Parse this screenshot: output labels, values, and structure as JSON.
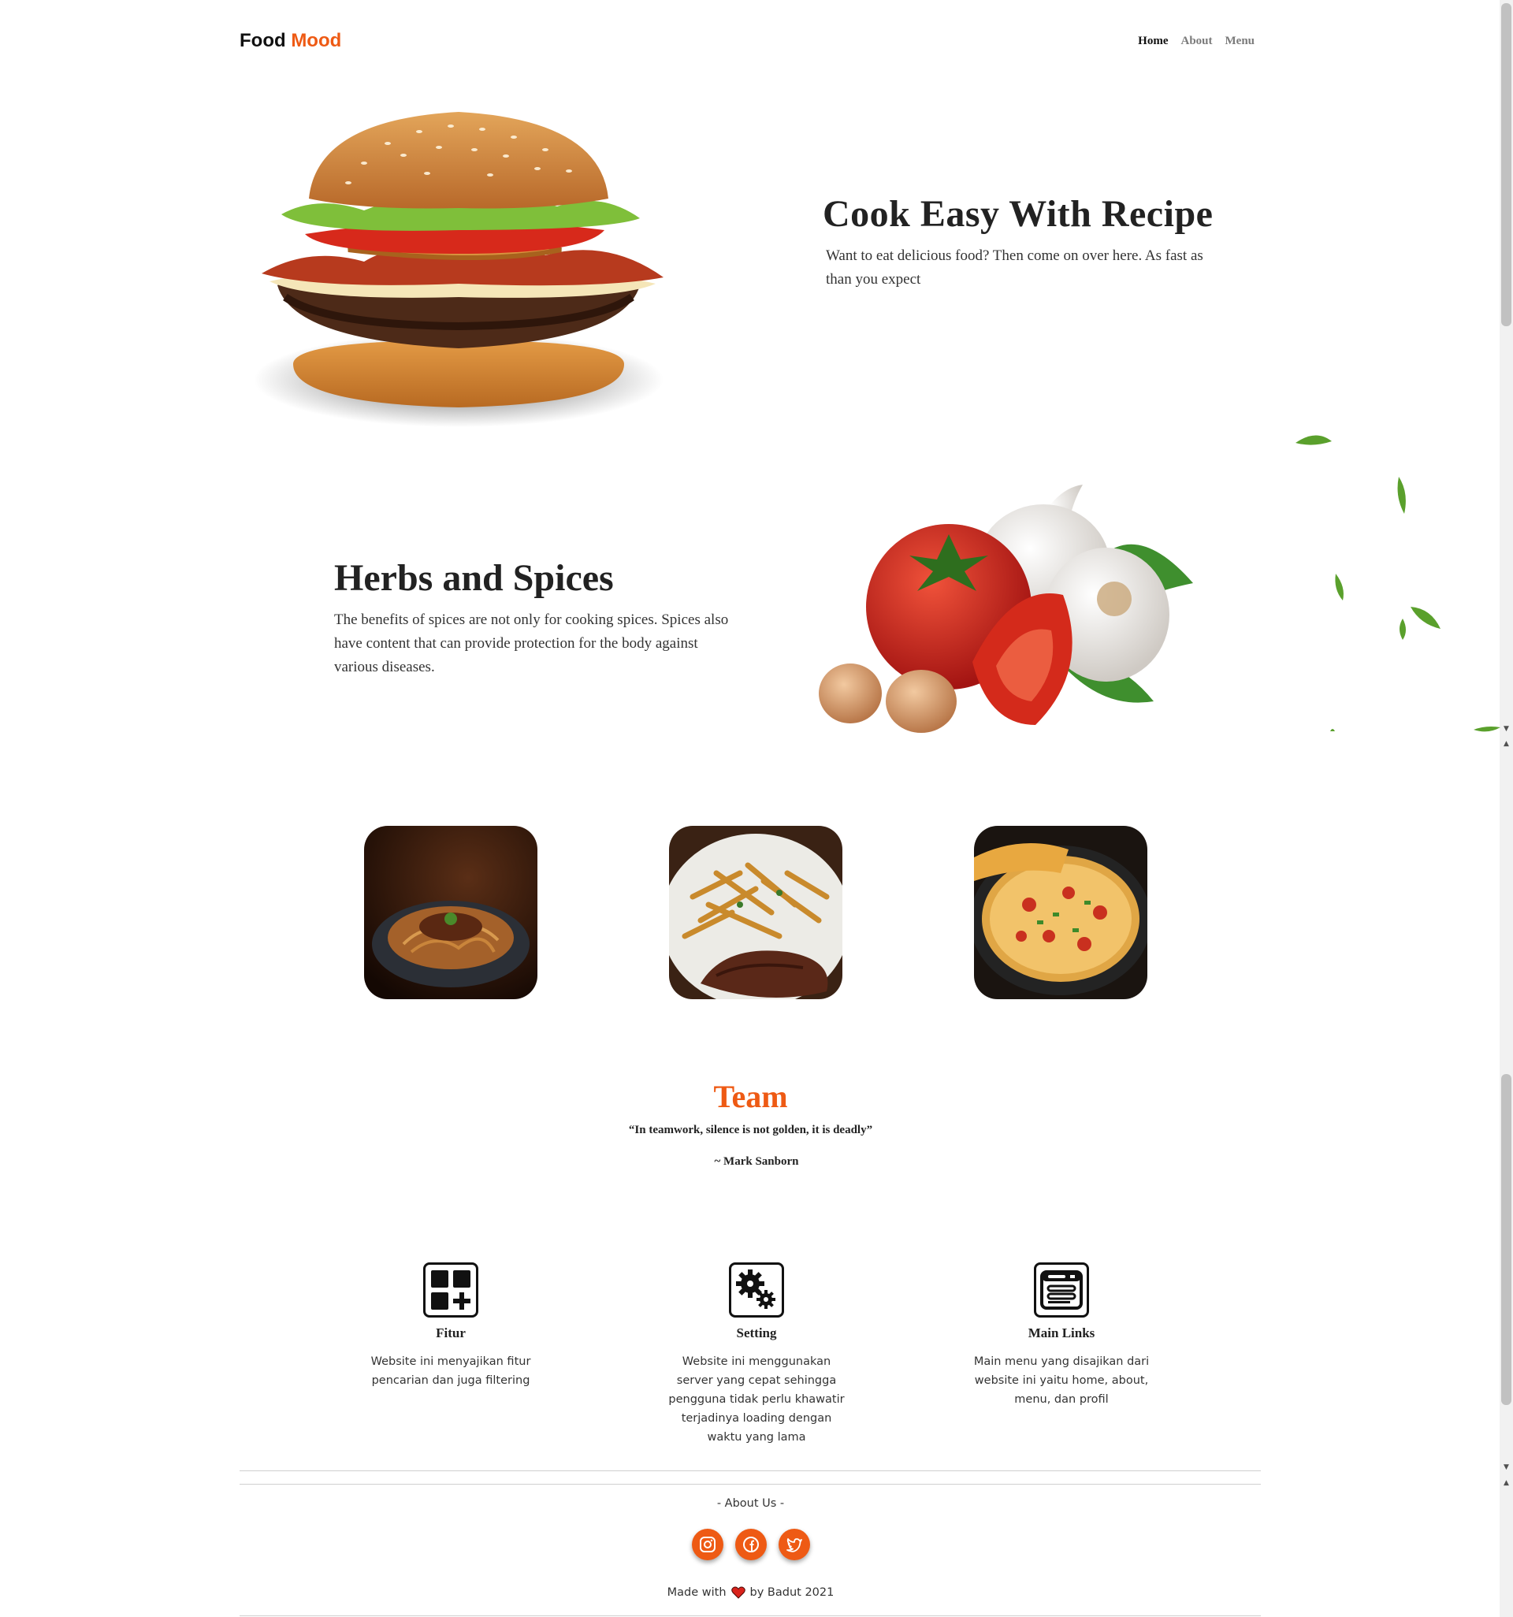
{
  "nav": {
    "brand_first": "Food",
    "brand_second": "Mood",
    "links": [
      "Home",
      "About",
      "Menu"
    ]
  },
  "hero": {
    "title": "Cook Easy With Recipe",
    "text": "Want to eat delicious food? Then come on over here. As fast as than you expect"
  },
  "herbs": {
    "title": "Herbs and Spices",
    "text": "The benefits of spices are not only for cooking spices. Spices also have content that can provide protection for the body against various diseases."
  },
  "team": {
    "title": "Team",
    "quote": "“In teamwork, silence is not golden, it is deadly”",
    "author": "~ Mark Sanborn"
  },
  "features": [
    {
      "title": "Fitur",
      "text": "Website ini menyajikan fitur pencarian dan juga filtering",
      "icon": "grid-plus-icon"
    },
    {
      "title": "Setting",
      "text": "Website ini menggunakan server yang cepat sehingga pengguna tidak perlu khawatir terjadinya loading dengan waktu yang lama",
      "icon": "gears-icon"
    },
    {
      "title": "Main Links",
      "text": "Main menu yang disajikan dari website ini yaitu home, about, menu, dan profil",
      "icon": "browser-window-icon"
    }
  ],
  "footer": {
    "about_label": "- About Us -",
    "made_with_prefix": "Made with",
    "made_with_suffix": "by Badut 2021",
    "socials": [
      "instagram-icon",
      "facebook-icon",
      "twitter-icon"
    ]
  },
  "colors": {
    "accent": "#ee5a14",
    "text": "#222222"
  }
}
